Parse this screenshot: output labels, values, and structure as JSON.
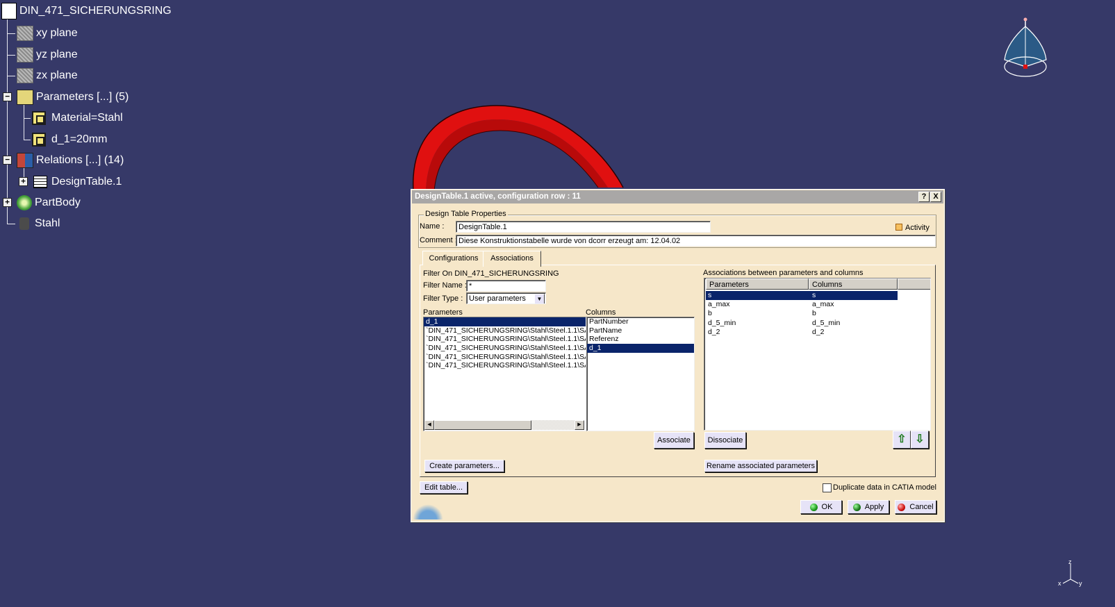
{
  "tree": {
    "root": "DIN_471_SICHERUNGSRING",
    "nodes": [
      {
        "label": "xy plane"
      },
      {
        "label": "yz plane"
      },
      {
        "label": "zx plane"
      },
      {
        "label": "Parameters [...] (5)"
      },
      {
        "label": "Material=Stahl"
      },
      {
        "label": "d_1=20mm"
      },
      {
        "label": "Relations [...] (14)"
      },
      {
        "label": "DesignTable.1"
      },
      {
        "label": "PartBody"
      },
      {
        "label": "Stahl"
      }
    ]
  },
  "dialog": {
    "title": "DesignTable.1 active, configuration row : 11",
    "help_btn": "?",
    "close_btn": "X",
    "properties_group": "Design Table Properties",
    "name_label": "Name :",
    "name_value": "DesignTable.1",
    "activity_label": "Activity",
    "comment_label": "Comment :",
    "comment_value": "Diese Konstruktionstabelle wurde von dcorr erzeugt am: 12.04.02",
    "tabs": [
      "Configurations",
      "Associations"
    ],
    "filter_on": "Filter On DIN_471_SICHERUNGSRING",
    "filter_name_label": "Filter Name :",
    "filter_name_value": "*",
    "filter_type_label": "Filter Type :",
    "filter_type_value": "User parameters",
    "parameters_label": "Parameters",
    "parameters": [
      "d_1",
      "`DIN_471_SICHERUNGSRING\\Stahl\\Steel.1.1\\SA",
      "`DIN_471_SICHERUNGSRING\\Stahl\\Steel.1.1\\SA",
      "`DIN_471_SICHERUNGSRING\\Stahl\\Steel.1.1\\SA",
      "`DIN_471_SICHERUNGSRING\\Stahl\\Steel.1.1\\SA",
      "`DIN_471_SICHERUNGSRING\\Stahl\\Steel.1.1\\SA"
    ],
    "columns_label": "Columns",
    "columns": [
      "PartNumber",
      "PartName",
      "Referenz",
      "d_1"
    ],
    "associate_btn": "Associate",
    "create_params_btn": "Create parameters...",
    "assoc_label": "Associations between parameters and columns",
    "assoc_headers": [
      "Parameters",
      "Columns"
    ],
    "assoc_rows": [
      [
        "s",
        "s"
      ],
      [
        "a_max",
        "a_max"
      ],
      [
        "b",
        "b"
      ],
      [
        "d_5_min",
        "d_5_min"
      ],
      [
        "d_2",
        "d_2"
      ]
    ],
    "dissociate_btn": "Dissociate",
    "rename_btn": "Rename associated parameters",
    "edit_table_btn": "Edit table...",
    "duplicate_label": "Duplicate data in CATIA model",
    "ok_btn": "OK",
    "apply_btn": "Apply",
    "cancel_btn": "Cancel"
  },
  "axis": {
    "x": "x",
    "y": "y",
    "z": "z"
  },
  "colors": {
    "background": "#363968",
    "part": "#e01010",
    "selection": "#0a246a",
    "dialog": "#f6e7c9"
  }
}
